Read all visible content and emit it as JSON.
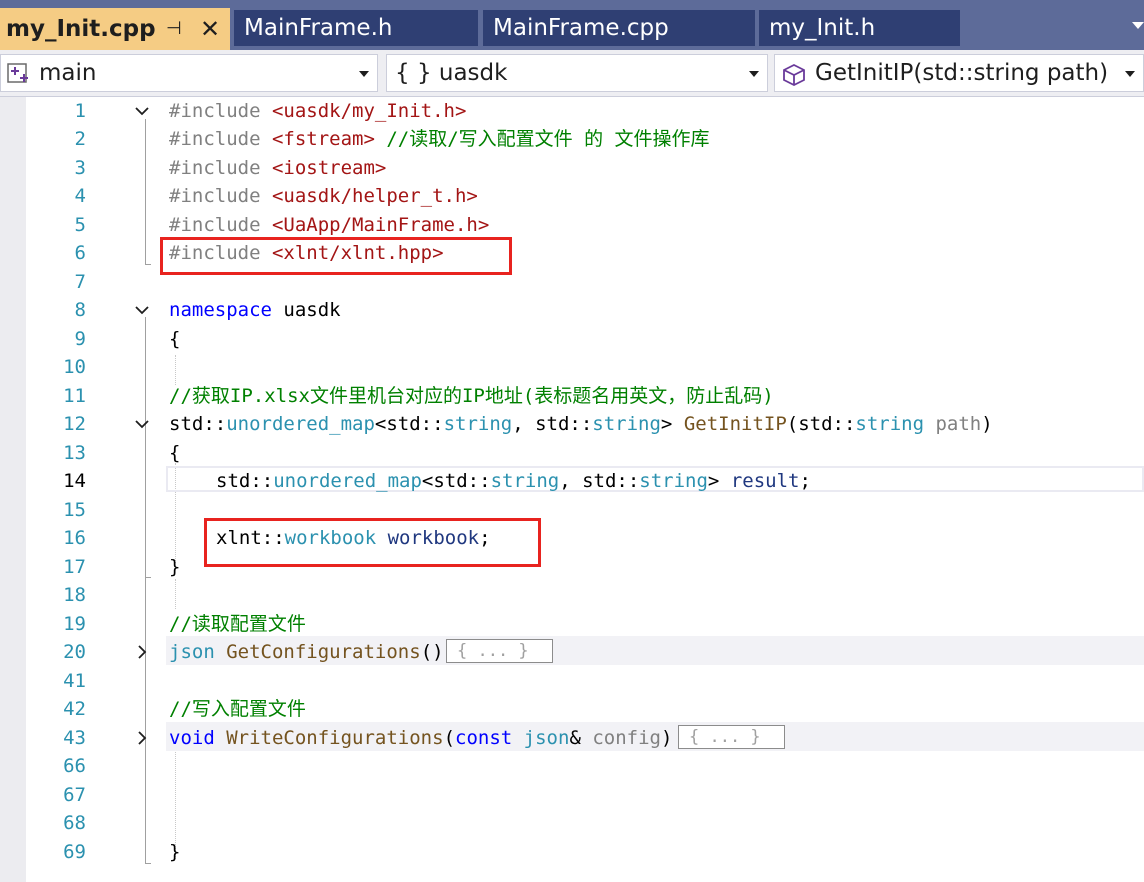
{
  "tabs": [
    {
      "label": "my_Init.cpp",
      "active": true,
      "pin": "⊣",
      "close": "✕"
    },
    {
      "label": "MainFrame.h",
      "active": false
    },
    {
      "label": "MainFrame.cpp",
      "active": false
    },
    {
      "label": "my_Init.h",
      "active": false
    }
  ],
  "navbar": {
    "project": "main",
    "scope": "{ } uasdk",
    "member": "GetInitIP(std::string path)"
  },
  "line_numbers": [
    "1",
    "2",
    "3",
    "4",
    "5",
    "6",
    "7",
    "8",
    "9",
    "10",
    "11",
    "12",
    "13",
    "14",
    "15",
    "16",
    "17",
    "18",
    "19",
    "20",
    "41",
    "42",
    "43",
    "66",
    "67",
    "68",
    "69"
  ],
  "current_line": "14",
  "code": {
    "l1": [
      "#include ",
      "<uasdk/my_Init.h>"
    ],
    "l2": [
      "#include ",
      "<fstream>",
      " //读取/写入配置文件 的 文件操作库"
    ],
    "l3": [
      "#include ",
      "<iostream>"
    ],
    "l4": [
      "#include ",
      "<uasdk/helper_t.h>"
    ],
    "l5": [
      "#include ",
      "<UaApp/MainFrame.h>"
    ],
    "l6": [
      "#include ",
      "<xlnt/xlnt.hpp>"
    ],
    "l8": [
      "namespace",
      " uasdk"
    ],
    "l9": "{",
    "l11": "//获取IP.xlsx文件里机台对应的IP地址(表标题名用英文，防止乱码)",
    "l12": [
      "std::",
      "unordered_map",
      "<std::",
      "string",
      ", std::",
      "string",
      "> ",
      "GetInitIP",
      "(std::",
      "string",
      " path",
      ")"
    ],
    "l13": "{",
    "l14": [
      "std::",
      "unordered_map",
      "<std::",
      "string",
      ", std::",
      "string",
      "> ",
      "result",
      ";"
    ],
    "l16": [
      "xlnt::",
      "workbook",
      " ",
      "workbook",
      ";"
    ],
    "l17": "}",
    "l19": "//读取配置文件",
    "l20": [
      "json",
      " ",
      "GetConfigurations",
      "()"
    ],
    "l20_collapsed": "{ ... }",
    "l42": "//写入配置文件",
    "l43": [
      "void",
      " ",
      "WriteConfigurations",
      "(",
      "const",
      " ",
      "json",
      "& ",
      "config",
      ")"
    ],
    "l43_collapsed": "{ ... }",
    "l69": "}"
  },
  "colors": {
    "tab_active": "#f5cc84",
    "tab_inactive": "#2f3f73",
    "tabbar": "#5d6b99",
    "highlight_box": "#e8231f",
    "comment": "#008000",
    "keyword": "#0000ff",
    "type": "#2b91af",
    "include_path": "#a31515"
  }
}
